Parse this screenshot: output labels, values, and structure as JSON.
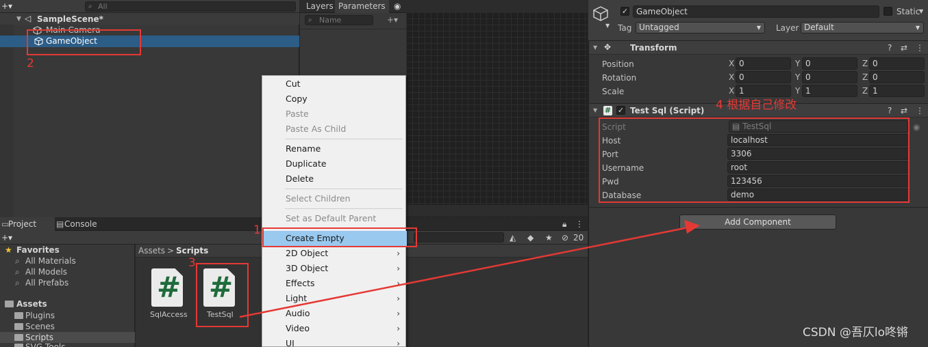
{
  "hierarchy": {
    "search_placeholder": "All",
    "scene": "SampleScene*",
    "items": [
      "Main Camera",
      "GameObject"
    ]
  },
  "animator": {
    "tabs": [
      "Layers",
      "Parameters"
    ],
    "search_placeholder": "Name"
  },
  "project": {
    "tabs": [
      "Project",
      "Console"
    ],
    "favorites_label": "Favorites",
    "favorites": [
      "All Materials",
      "All Models",
      "All Prefabs"
    ],
    "assets_label": "Assets",
    "folders": [
      "Plugins",
      "Scenes",
      "Scripts",
      "SVG Tools"
    ],
    "breadcrumb_root": "Assets",
    "breadcrumb_sep": ">",
    "breadcrumb_current": "Scripts",
    "files": [
      "SqlAccess",
      "TestSql"
    ],
    "hidden_count": "20"
  },
  "context_menu": {
    "items": [
      {
        "label": "Cut",
        "disabled": false
      },
      {
        "label": "Copy",
        "disabled": false
      },
      {
        "label": "Paste",
        "disabled": true
      },
      {
        "label": "Paste As Child",
        "disabled": true
      },
      {
        "label": "Rename",
        "disabled": false
      },
      {
        "label": "Duplicate",
        "disabled": false
      },
      {
        "label": "Delete",
        "disabled": false
      },
      {
        "label": "Select Children",
        "disabled": true
      },
      {
        "label": "Set as Default Parent",
        "disabled": true
      },
      {
        "label": "Create Empty",
        "disabled": false,
        "highlighted": true
      },
      {
        "label": "2D Object",
        "submenu": true
      },
      {
        "label": "3D Object",
        "submenu": true
      },
      {
        "label": "Effects",
        "submenu": true
      },
      {
        "label": "Light",
        "submenu": true
      },
      {
        "label": "Audio",
        "submenu": true
      },
      {
        "label": "Video",
        "submenu": true
      },
      {
        "label": "UI",
        "submenu": true
      }
    ],
    "submenu_arrow": "›"
  },
  "inspector": {
    "object_name": "GameObject",
    "static_label": "Static",
    "tag_label": "Tag",
    "tag_value": "Untagged",
    "layer_label": "Layer",
    "layer_value": "Default",
    "transform": {
      "title": "Transform",
      "rows": [
        {
          "label": "Position",
          "x": "0",
          "y": "0",
          "z": "0"
        },
        {
          "label": "Rotation",
          "x": "0",
          "y": "0",
          "z": "0"
        },
        {
          "label": "Scale",
          "x": "1",
          "y": "1",
          "z": "1"
        }
      ],
      "axis_labels": [
        "X",
        "Y",
        "Z"
      ]
    },
    "script_component": {
      "title": "Test Sql (Script)",
      "fields": [
        {
          "label": "Script",
          "value": "TestSql",
          "readonly": true
        },
        {
          "label": "Host",
          "value": "localhost"
        },
        {
          "label": "Port",
          "value": "3306"
        },
        {
          "label": "Username",
          "value": "root"
        },
        {
          "label": "Pwd",
          "value": "123456"
        },
        {
          "label": "Database",
          "value": "demo"
        }
      ]
    },
    "add_component": "Add Component"
  },
  "annotations": {
    "step1": "1",
    "step2": "2",
    "step3": "3",
    "step4": "4 根据自己修改",
    "accent": "#e53935"
  },
  "watermark": "CSDN @吾仄lo咚锵"
}
